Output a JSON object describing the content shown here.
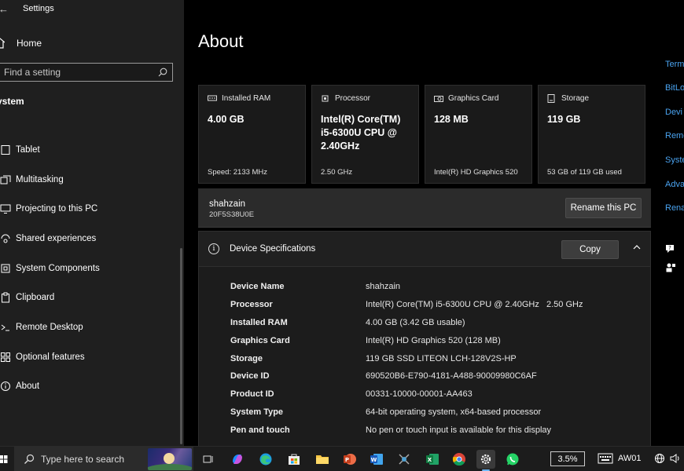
{
  "window": {
    "title": "Settings"
  },
  "sidebar": {
    "home_label": "Home",
    "search_placeholder": "Find a setting",
    "section_label": "ystem",
    "items": [
      {
        "label": "Tablet",
        "icon": "tablet-icon"
      },
      {
        "label": "Multitasking",
        "icon": "multitasking-icon"
      },
      {
        "label": "Projecting to this PC",
        "icon": "projecting-icon"
      },
      {
        "label": "Shared experiences",
        "icon": "shared-experiences-icon"
      },
      {
        "label": "System Components",
        "icon": "system-components-icon"
      },
      {
        "label": "Clipboard",
        "icon": "clipboard-icon"
      },
      {
        "label": "Remote Desktop",
        "icon": "remote-desktop-icon"
      },
      {
        "label": "Optional features",
        "icon": "optional-features-icon"
      },
      {
        "label": "About",
        "icon": "info-icon"
      }
    ]
  },
  "main": {
    "title": "About",
    "cards": [
      {
        "header": "Installed RAM",
        "value": "4.00 GB",
        "sub": "Speed: 2133 MHz",
        "icon": "ram-icon"
      },
      {
        "header": "Processor",
        "value": "Intel(R) Core(TM) i5-6300U CPU @ 2.40GHz",
        "sub": "2.50 GHz",
        "icon": "processor-icon"
      },
      {
        "header": "Graphics Card",
        "value": "128 MB",
        "sub": "Intel(R) HD Graphics 520",
        "icon": "graphics-card-icon"
      },
      {
        "header": "Storage",
        "value": "119 GB",
        "sub": "53 GB of 119 GB used",
        "icon": "storage-icon"
      }
    ],
    "pc": {
      "name": "shahzain",
      "id": "20F5S38U0E",
      "rename_label": "Rename this PC"
    },
    "specs": {
      "title": "Device Specifications",
      "copy_label": "Copy",
      "rows": [
        {
          "key": "Device Name",
          "value": "shahzain"
        },
        {
          "key": "Processor",
          "value": "Intel(R) Core(TM) i5-6300U CPU @ 2.40GHz   2.50 GHz"
        },
        {
          "key": "Installed RAM",
          "value": "4.00 GB (3.42 GB usable)"
        },
        {
          "key": "Graphics Card",
          "value": "Intel(R) HD Graphics 520 (128 MB)"
        },
        {
          "key": "Storage",
          "value": "119 GB SSD LITEON LCH-128V2S-HP"
        },
        {
          "key": "Device ID",
          "value": "690520B6-E790-4181-A488-90009980C6AF"
        },
        {
          "key": "Product ID",
          "value": "00331-10000-00001-AA463"
        },
        {
          "key": "System Type",
          "value": "64-bit operating system, x64-based processor"
        },
        {
          "key": "Pen and touch",
          "value": "No pen or touch input is available for this display"
        }
      ]
    }
  },
  "related": {
    "links": [
      "Term",
      "BitLo",
      "Devi",
      "Remo",
      "Syste",
      "Adva",
      "Rena"
    ]
  },
  "taskbar": {
    "search_placeholder": "Type here to search",
    "battery_percent": "3.5%",
    "keyboard_label": "AW01"
  },
  "colors": {
    "accent_link": "#4aa3f0",
    "active_indicator": "#6cb6f5"
  }
}
